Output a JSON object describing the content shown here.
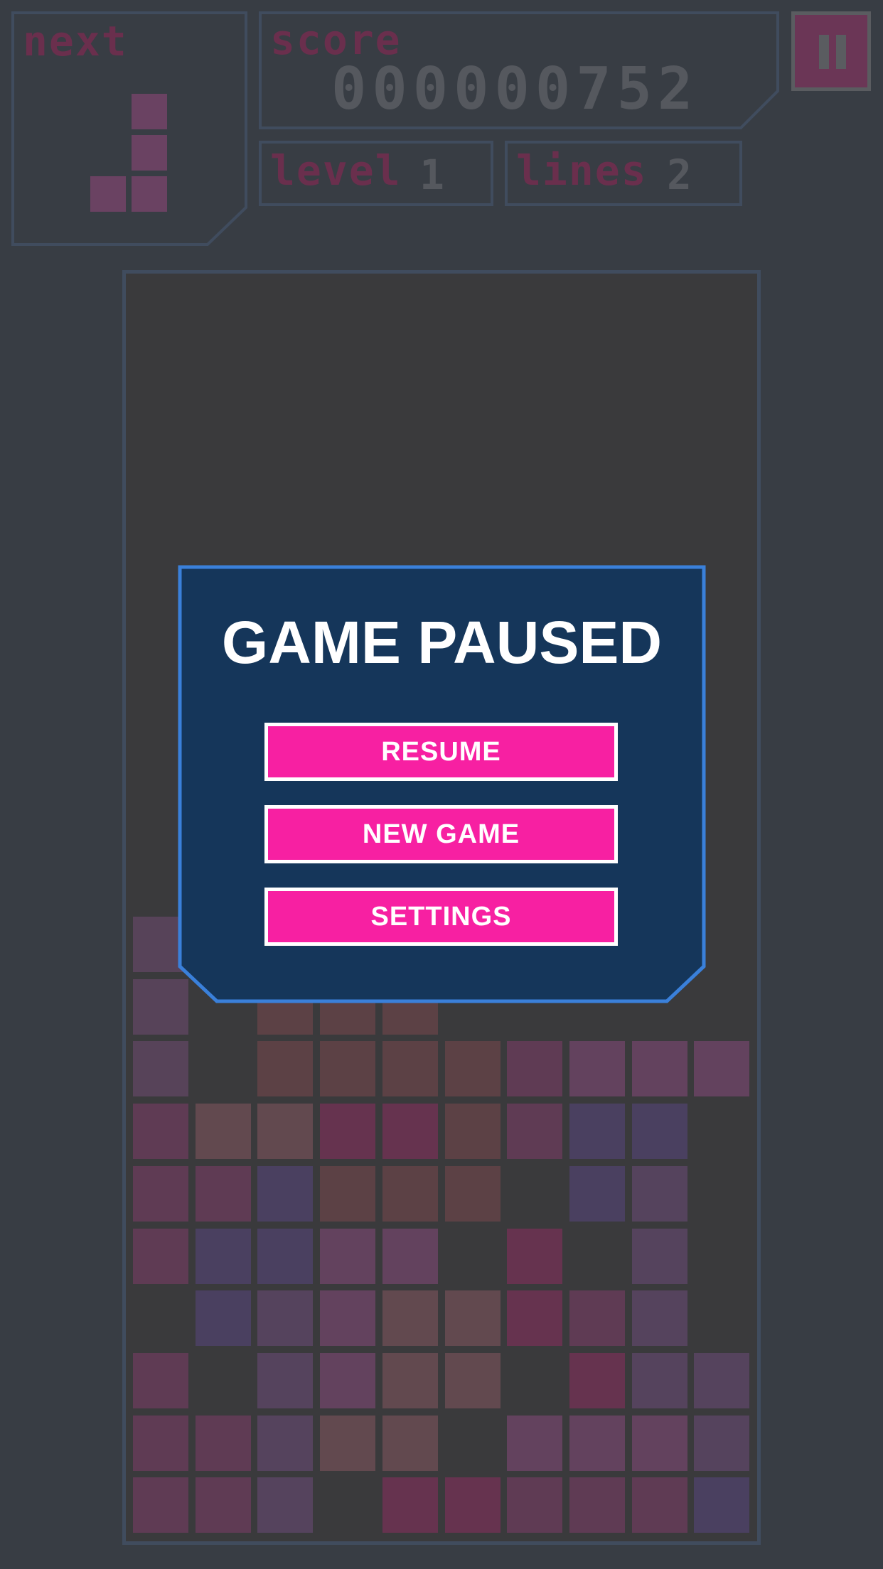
{
  "hud": {
    "next_label": "next",
    "score_label": "score",
    "score_value": "000000752",
    "level_label": "level",
    "level_value": "1",
    "lines_label": "lines",
    "lines_value": "2"
  },
  "next_piece": {
    "shape": "J",
    "color": "#6a4262",
    "cells": [
      [
        0,
        1
      ],
      [
        1,
        1
      ],
      [
        2,
        0
      ],
      [
        2,
        1
      ]
    ]
  },
  "board": {
    "columns": 10,
    "rows": 25,
    "palette": {
      "a": "#574359",
      "b": "#5c4145",
      "c": "#5f3b54",
      "d": "#63425e",
      "e": "#62494f",
      "f": "#66334f",
      "g": "#4a4060",
      "h": "#55435d"
    },
    "grid_bottom_rows": [
      "a.........",
      "a.bbb.....",
      "a.bbbbcddd",
      "ceeffbcgg.",
      "ccgbbb.gh.",
      "cggdd.f.h.",
      ".ghdeefch.",
      "c.hdee.fhh",
      "cchee.dddh",
      "cch.ffcccg"
    ]
  },
  "pause_button": {
    "icon": "pause-icon"
  },
  "dialog": {
    "title": "GAME PAUSED",
    "buttons": [
      "RESUME",
      "NEW GAME",
      "SETTINGS"
    ],
    "accent_color": "#f720a2",
    "background_color": "#15365a",
    "border_color": "#3a80da"
  }
}
